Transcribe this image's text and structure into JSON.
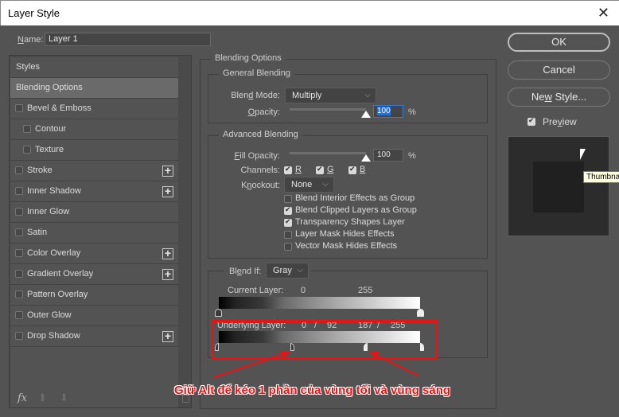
{
  "window": {
    "title": "Layer Style",
    "close_icon": "close-icon"
  },
  "name_field": {
    "label": "Name:",
    "value": "Layer 1"
  },
  "styles_list": {
    "items": [
      {
        "label": "Styles",
        "checkbox": false,
        "plus": false,
        "indent": 0,
        "selected": false
      },
      {
        "label": "Blending Options",
        "checkbox": false,
        "plus": false,
        "indent": 0,
        "selected": true
      },
      {
        "label": "Bevel & Emboss",
        "checkbox": true,
        "checked": false,
        "plus": false,
        "indent": 0
      },
      {
        "label": "Contour",
        "checkbox": true,
        "checked": false,
        "plus": false,
        "indent": 1
      },
      {
        "label": "Texture",
        "checkbox": true,
        "checked": false,
        "plus": false,
        "indent": 1
      },
      {
        "label": "Stroke",
        "checkbox": true,
        "checked": false,
        "plus": true,
        "indent": 0
      },
      {
        "label": "Inner Shadow",
        "checkbox": true,
        "checked": false,
        "plus": true,
        "indent": 0
      },
      {
        "label": "Inner Glow",
        "checkbox": true,
        "checked": false,
        "plus": false,
        "indent": 0
      },
      {
        "label": "Satin",
        "checkbox": true,
        "checked": false,
        "plus": false,
        "indent": 0
      },
      {
        "label": "Color Overlay",
        "checkbox": true,
        "checked": false,
        "plus": true,
        "indent": 0
      },
      {
        "label": "Gradient Overlay",
        "checkbox": true,
        "checked": false,
        "plus": true,
        "indent": 0
      },
      {
        "label": "Pattern Overlay",
        "checkbox": true,
        "checked": false,
        "plus": false,
        "indent": 0
      },
      {
        "label": "Outer Glow",
        "checkbox": true,
        "checked": false,
        "plus": false,
        "indent": 0
      },
      {
        "label": "Drop Shadow",
        "checkbox": true,
        "checked": false,
        "plus": true,
        "indent": 0
      }
    ],
    "footer": {
      "fx_label": "fx",
      "up_icon": "arrow-up-icon",
      "down_icon": "arrow-down-icon",
      "trash_icon": "trash-icon"
    }
  },
  "blending_options": {
    "title": "Blending Options",
    "general": {
      "title": "General Blending",
      "blend_mode_label": "Blend Mode:",
      "blend_mode_value": "Multiply",
      "opacity_label": "Opacity:",
      "opacity_value": "100",
      "opacity_percent": 100,
      "unit": "%"
    },
    "advanced": {
      "title": "Advanced Blending",
      "fill_opacity_label": "Fill Opacity:",
      "fill_opacity_value": "100",
      "fill_opacity_percent": 100,
      "unit": "%",
      "channels_label": "Channels:",
      "channels": [
        {
          "label": "R",
          "checked": true
        },
        {
          "label": "G",
          "checked": true
        },
        {
          "label": "B",
          "checked": true
        }
      ],
      "knockout_label": "Knockout:",
      "knockout_value": "None",
      "options": [
        {
          "label": "Blend Interior Effects as Group",
          "checked": false
        },
        {
          "label": "Blend Clipped Layers as Group",
          "checked": true
        },
        {
          "label": "Transparency Shapes Layer",
          "checked": true
        },
        {
          "label": "Layer Mask Hides Effects",
          "checked": false
        },
        {
          "label": "Vector Mask Hides Effects",
          "checked": false
        }
      ]
    },
    "blend_if": {
      "label": "Blend If:",
      "value": "Gray",
      "current_layer": {
        "label": "Current Layer:",
        "low": "0",
        "high": "255"
      },
      "underlying_layer": {
        "label": "Underlying Layer:",
        "low": "0",
        "sep1": "/",
        "low_split": "92",
        "high_split": "187",
        "sep2": "/",
        "high": "255"
      }
    }
  },
  "buttons": {
    "ok": "OK",
    "cancel": "Cancel",
    "new_style": "New Style...",
    "preview_label": "Preview",
    "preview_checked": true
  },
  "tooltip": "Thumbnail",
  "annotation": {
    "text": "Giữ Alt để kéo 1 phần của vùng tối và vùng sáng",
    "color": "#ee1111"
  }
}
